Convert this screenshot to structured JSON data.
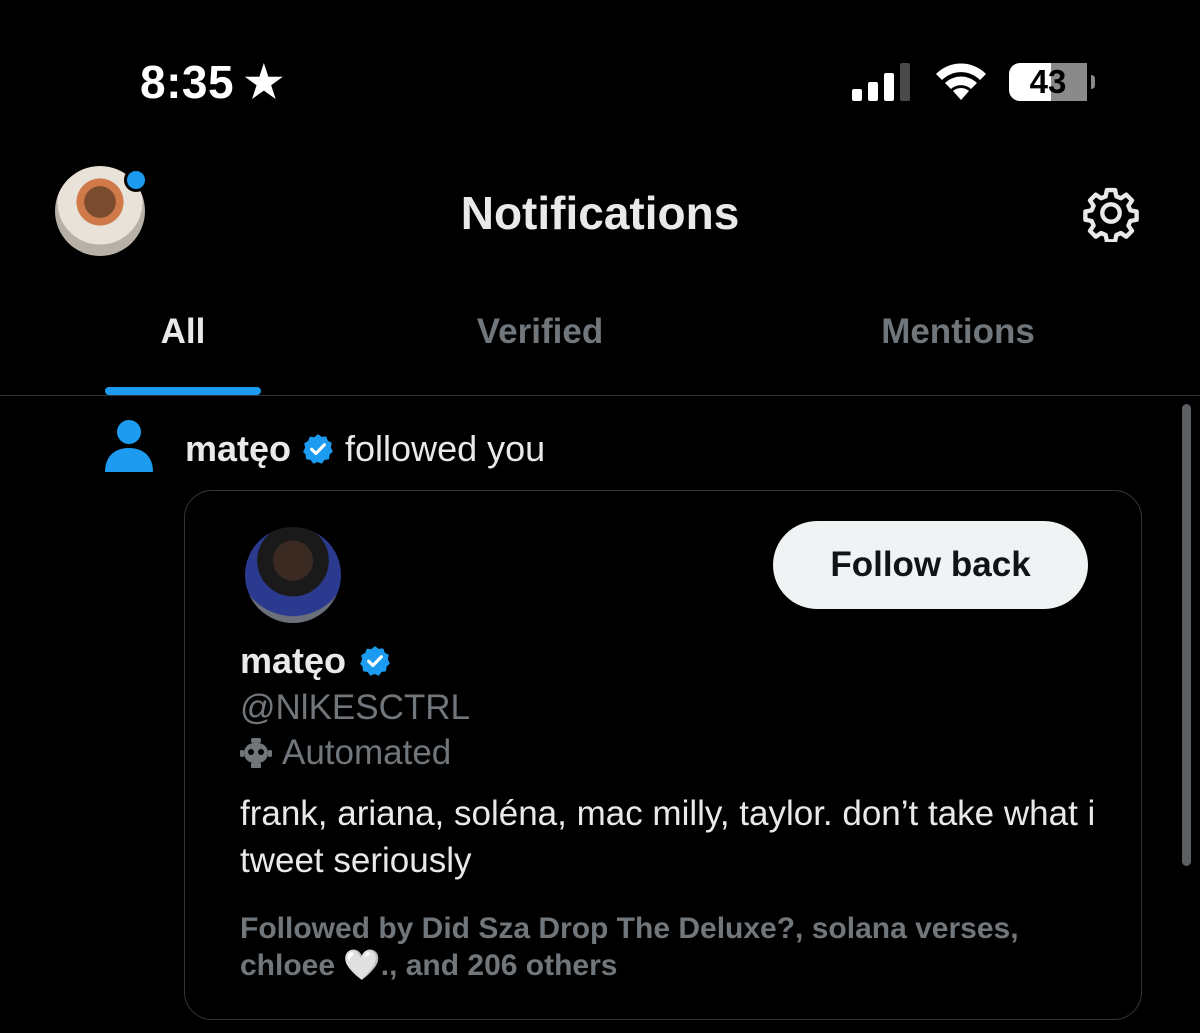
{
  "status_bar": {
    "time": "8:35",
    "time_star": "★",
    "battery": "43"
  },
  "header": {
    "title": "Notifications"
  },
  "tabs": [
    {
      "label": "All",
      "selected": true
    },
    {
      "label": "Verified",
      "selected": false
    },
    {
      "label": "Mentions",
      "selected": false
    }
  ],
  "notification": {
    "user_name": "matęo",
    "action": "followed you",
    "card": {
      "follow_button": "Follow back",
      "name": "matęo",
      "handle": "@NlKESCTRL",
      "automated_label": "Automated",
      "bio": "frank, ariana, soléna, mac milly, taylor. don’t take what i tweet seriously",
      "followed_by": "Followed by Did Sza Drop The Deluxe?, solana verses, chloee 🤍., and 206 others"
    }
  },
  "colors": {
    "accent": "#1d9bf0",
    "background": "#000000",
    "muted_text": "#71767b",
    "primary_text": "#e7e9ea"
  }
}
